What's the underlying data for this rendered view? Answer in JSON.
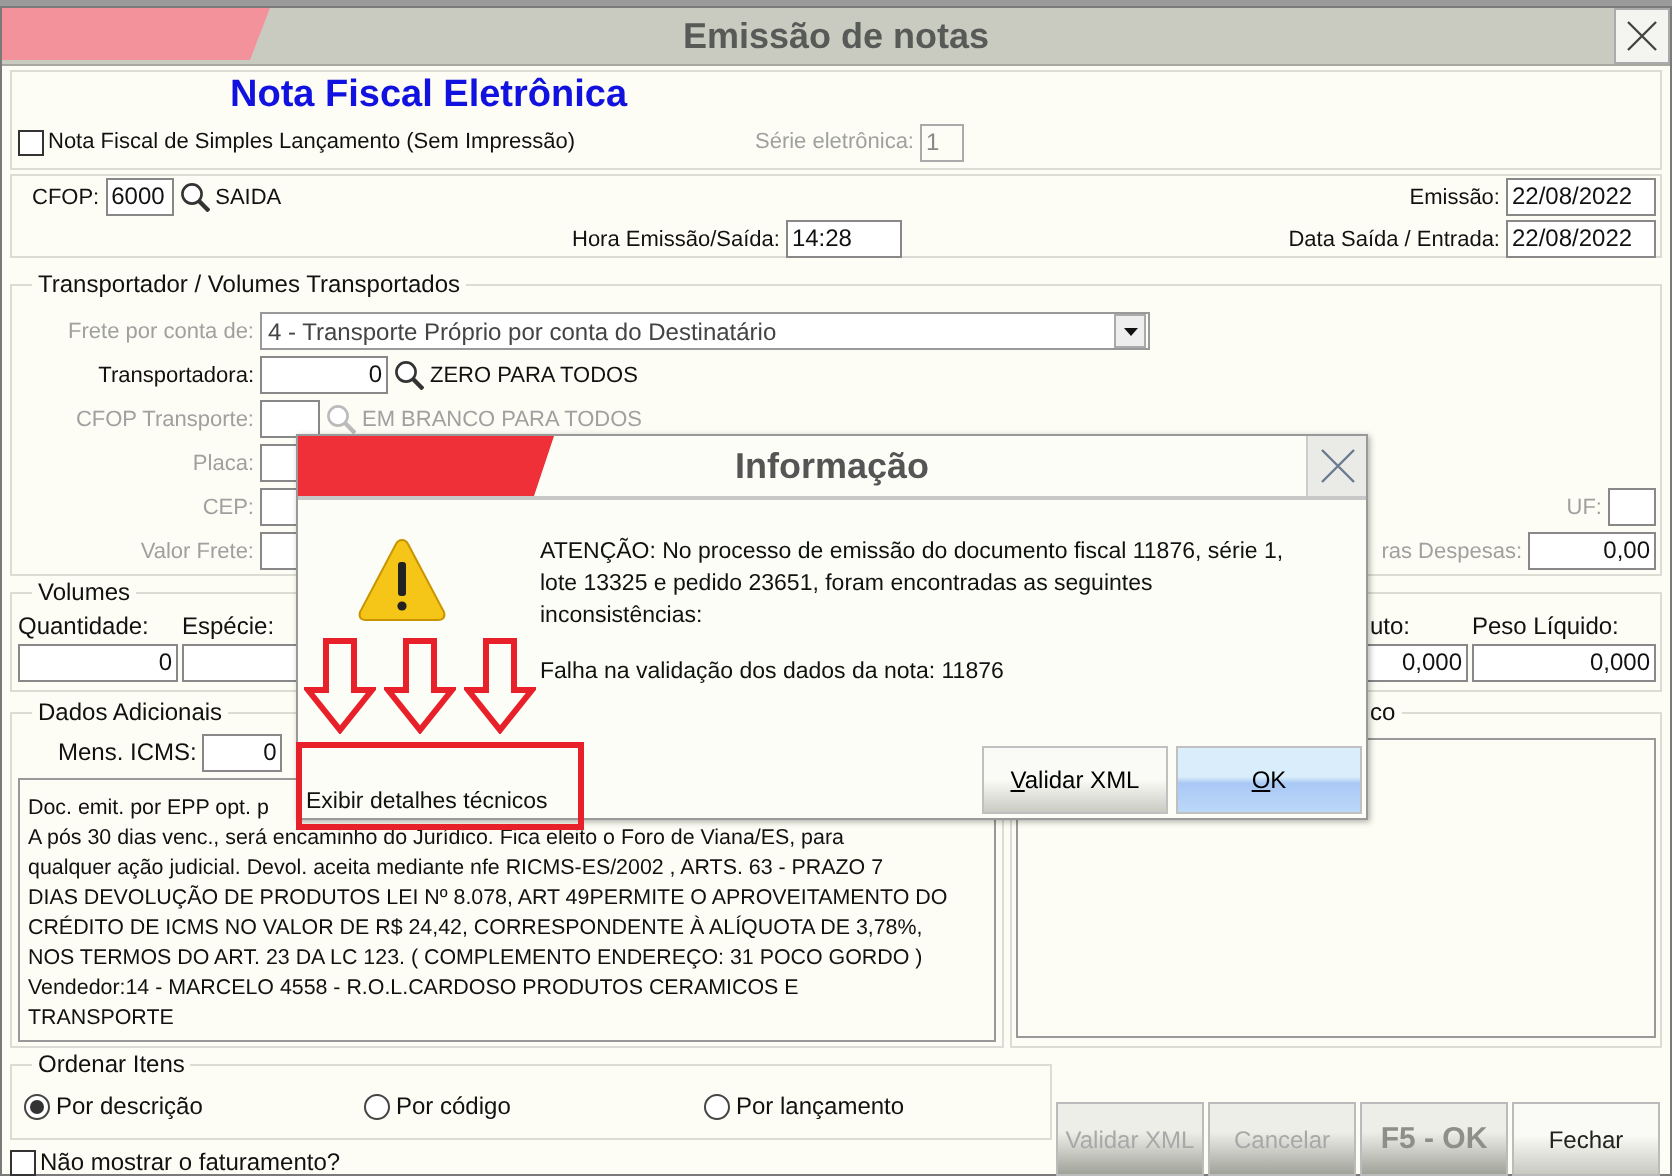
{
  "window": {
    "title": "Emissão de notas"
  },
  "header": {
    "title": "Nota Fiscal Eletrônica",
    "simple_launch": {
      "label": "Nota Fiscal de Simples Lançamento (Sem Impressão)",
      "checked": false
    },
    "serie": {
      "label": "Série eletrônica:",
      "value": "1",
      "disabled": true
    }
  },
  "cfop": {
    "label": "CFOP:",
    "value": "6000",
    "description": "SAIDA"
  },
  "emissao": {
    "label": "Emissão:",
    "value": "22/08/2022"
  },
  "hora": {
    "label": "Hora Emissão/Saída:",
    "value": "14:28"
  },
  "data_saida": {
    "label": "Data Saída / Entrada:",
    "value": "22/08/2022"
  },
  "transport": {
    "legend": "Transportador /  Volumes Transportados",
    "frete": {
      "label": "Frete por conta de:",
      "value": "4 - Transporte Próprio por conta do Destinatário",
      "disabled": true
    },
    "transportadora": {
      "label": "Transportadora:",
      "value": "0",
      "hint": "ZERO PARA TODOS",
      "disabled": false
    },
    "cfop_transporte": {
      "label": "CFOP Transporte:",
      "hint": "EM BRANCO PARA TODOS",
      "disabled": true
    },
    "placa": {
      "label": "Placa:",
      "disabled": true
    },
    "cep": {
      "label": "CEP:",
      "disabled": true
    },
    "uf": {
      "label": "UF:",
      "disabled": true
    },
    "valor_frete": {
      "label": "Valor Frete:",
      "disabled": true
    },
    "outras_despesas": {
      "label": "ras Despesas:",
      "value": "0,00",
      "disabled": true
    }
  },
  "volumes": {
    "legend": "Volumes",
    "left": [
      {
        "label": "Quantidade:",
        "value": "0"
      },
      {
        "label": "Espécie:"
      }
    ],
    "right": [
      {
        "label": "uto:",
        "value": "0,000"
      },
      {
        "label": "Peso Líquido:",
        "value": "0,000"
      }
    ]
  },
  "dados": {
    "legend": "Dados Adicionais",
    "mens_icms": {
      "label": "Mens. ICMS:",
      "value": "0"
    },
    "text_lines": [
      "Doc. emit. por EPP opt. p",
      "A pós 30 dias venc., será encaminho do Jurídico. Fica eleito o Foro de Viana/ES, para",
      "qualquer ação judicial. Devol. aceita mediante nfe RICMS-ES/2002 , ARTS. 63 -  PRAZO 7",
      "DIAS DEVOLUÇÃO DE PRODUTOS LEI Nº 8.078, ART 49PERMITE O APROVEITAMENTO DO",
      "CRÉDITO DE ICMS NO VALOR DE R$ 24,42, CORRESPONDENTE À ALÍQUOTA DE 3,78%,",
      "NOS TERMOS DO ART. 23 DA LC 123. ( COMPLEMENTO ENDEREÇO: 31 POCO GORDO )",
      "Vendedor:14 - MARCELO 4558 - R.O.L.CARDOSO PRODUTOS CERAMICOS E",
      "TRANSPORTE"
    ]
  },
  "right_panel": {
    "legend": "co"
  },
  "ordenar": {
    "legend": "Ordenar Itens",
    "options": [
      {
        "label": "Por descrição",
        "selected": true
      },
      {
        "label": "Por código",
        "selected": false
      },
      {
        "label": "Por lançamento",
        "selected": false
      }
    ]
  },
  "no_billing": {
    "label": "Não mostrar o faturamento?",
    "checked": false
  },
  "buttons": [
    {
      "label": "Validar XML",
      "kind": "normal",
      "disabled": true
    },
    {
      "label": "Cancelar",
      "kind": "normal",
      "disabled": true
    },
    {
      "label": "F5 - OK",
      "kind": "primary",
      "disabled": true
    },
    {
      "label": "Fechar",
      "kind": "normal",
      "disabled": false
    }
  ],
  "dialog": {
    "title": "Informação",
    "message_lines": [
      "ATENÇÃO: No processo de emissão do documento fiscal 11876, série 1,",
      "lote 13325 e pedido 23651, foram encontradas as seguintes",
      "inconsistências:"
    ],
    "error": "Falha na validação dos dados da nota: 11876",
    "details_link": "Exibir detalhes técnicos",
    "buttons": [
      {
        "label": "Validar XML",
        "default": false
      },
      {
        "label": "OK",
        "default": true
      }
    ]
  },
  "annotations": [
    {
      "kind": "arrow"
    },
    {
      "kind": "arrow"
    },
    {
      "kind": "arrow"
    },
    {
      "kind": "box"
    }
  ]
}
